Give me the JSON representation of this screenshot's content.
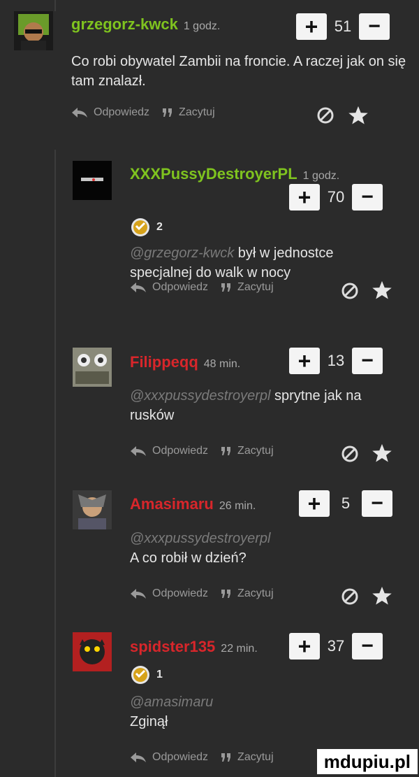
{
  "comments": [
    {
      "user": "grzegorz-kwck",
      "time": "1 godz.",
      "votes": "51",
      "text": "Co robi obywatel Zambii na froncie. A raczej jak on się tam znalazł."
    },
    {
      "user": "XXXPussyDestroyerPL",
      "time": "1 godz.",
      "votes": "70",
      "badge_count": "2",
      "mention": "@grzegorz-kwck",
      "text": " był w jednostce specjalnej do walk w nocy"
    },
    {
      "user": "Filippeqq",
      "time": "48 min.",
      "votes": "13",
      "mention": "@xxxpussydestroyerpl",
      "text": " sprytne jak na rusków"
    },
    {
      "user": "Amasimaru",
      "time": "26 min.",
      "votes": "5",
      "mention": "@xxxpussydestroyerpl",
      "text": "A co robił w dzień?"
    },
    {
      "user": "spidster135",
      "time": "22 min.",
      "votes": "37",
      "badge_count": "1",
      "mention": "@amasimaru",
      "text": "Zginął"
    }
  ],
  "vote": {
    "plus": "+",
    "minus": "−"
  },
  "actions": {
    "reply": "Odpowiedz",
    "quote": "Zacytuj"
  },
  "watermark": "mdupiu.pl",
  "icons": {
    "reply": "reply-arrow-icon",
    "quote": "quote-icon",
    "report": "report-icon",
    "favorite": "star-icon",
    "badge": "coin-badge-icon"
  },
  "colors": {
    "background": "#2b2b2b",
    "username_green": "#7fc31f",
    "username_red": "#d8262b",
    "vote_button": "#f4f4f4"
  }
}
